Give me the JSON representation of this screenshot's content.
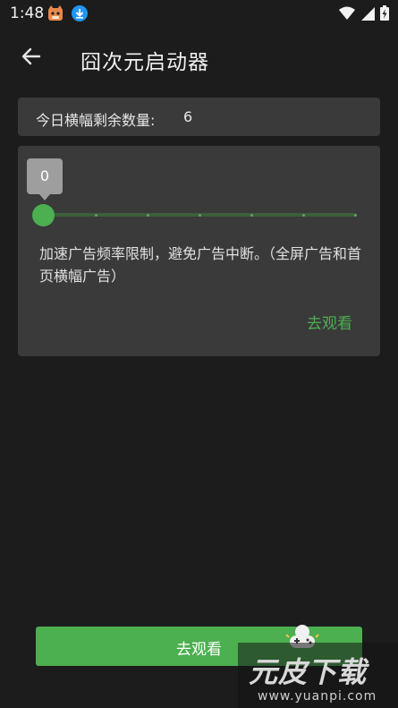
{
  "status_bar": {
    "time": "1:48",
    "icons": [
      "cat-notification-icon",
      "download-icon",
      "wifi-icon",
      "signal-icon",
      "battery-icon"
    ]
  },
  "app_bar": {
    "title": "囧次元启动器",
    "back_icon": "arrow-back-icon"
  },
  "banner_count": {
    "label": "今日横幅剩余数量:",
    "value": "6"
  },
  "ad_card": {
    "slider_value": "0",
    "description": "加速广告频率限制，避免广告中断。（全屏广告和首页横幅广告）",
    "link_label": "去观看"
  },
  "bottom_button": {
    "label": "去观看"
  },
  "watermark": {
    "brand": "元皮下载",
    "url": "www.yuanpi.com"
  },
  "colors": {
    "background": "#1c1c1c",
    "card": "#3a3a3a",
    "accent": "#4caf50",
    "tooltip": "#9e9e9e"
  }
}
